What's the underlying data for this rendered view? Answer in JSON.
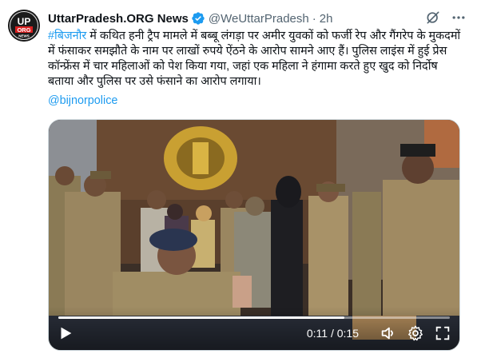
{
  "account": {
    "display_name": "UttarPradesh.ORG News",
    "handle": "@WeUttarPradesh",
    "separator": "·",
    "time": "2h",
    "avatar_text_top": "UP",
    "avatar_text_mid": "ORG",
    "avatar_text_bottom": "NEWS"
  },
  "tweet": {
    "hashtag": "#बिजनौर",
    "text": " में कथित हनी ट्रैप मामले में बब्बू लंगड़ा पर अमीर युवकों को फर्जी रेप और गैंगरेप के मुकदमों में फंसाकर समझौते के नाम पर लाखों रुपये ऐंठने के आरोप सामने आए हैं। पुलिस लाइंस में हुई प्रेस कॉन्फ्रेंस में चार महिलाओं को पेश किया गया, जहां एक महिला ने हंगामा करते हुए खुद को निर्दोष बताया और पुलिस पर उसे फंसाने का आरोप लगाया।",
    "mention": "@bijnorpolice"
  },
  "video": {
    "current_time": "0:11",
    "separator": " / ",
    "duration": "0:15",
    "progress": 0.73
  },
  "icons": {
    "verified": "verified-badge-icon",
    "grok": "grok-icon",
    "more": "more-icon",
    "play": "play-icon",
    "volume": "volume-icon",
    "settings": "settings-gear-icon",
    "fullscreen": "fullscreen-icon"
  },
  "colors": {
    "link": "#1d9bf0",
    "text": "#0f1419",
    "muted": "#536471"
  }
}
